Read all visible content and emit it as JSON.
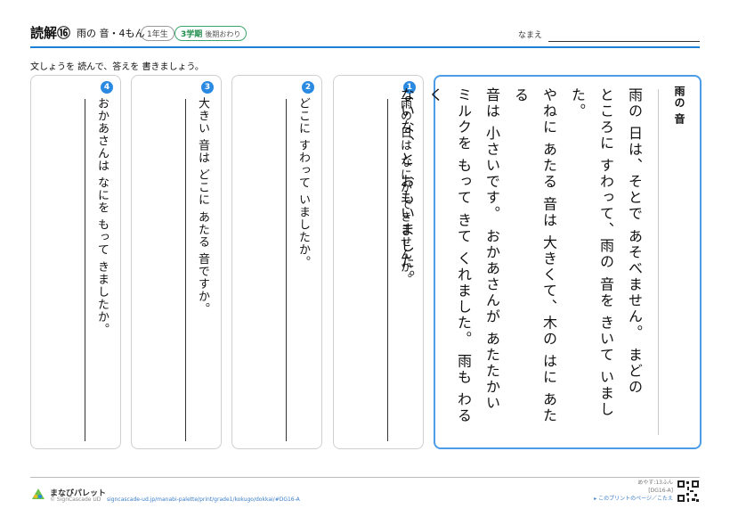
{
  "header": {
    "title": "読解⑯",
    "subtitle": "雨の 音・4もん",
    "grade_badge": "1年生",
    "term_badge": "3学期",
    "term_sub": "後期おわり",
    "name_label": "なまえ"
  },
  "instruction": "文しょうを 読んで、答えを 書きましょう。",
  "questions": [
    {
      "num": "1",
      "text": "雨の 日は なにが できませんか。"
    },
    {
      "num": "2",
      "text": "どこに すわって いましたか。"
    },
    {
      "num": "3",
      "text": "大きい 音は どこに あたる 音ですか。"
    },
    {
      "num": "4",
      "text": "おかあさんは なにを もって きましたか。"
    }
  ],
  "story": {
    "title": "雨の 音",
    "lines": [
      "雨の 日は、そとで あそべません。 まどの",
      "ところに すわって、雨の 音を きいて いました。",
      "やねに あたる 音は 大きくて、木の はに あたる",
      "音は 小さいです。 おかあさんが あたたかい",
      "ミルクを もって きて くれました。 雨も わるく",
      "ないな、と おもいました。"
    ]
  },
  "footer": {
    "brand": "まなびパレット",
    "copyright": "© SignCascade UD",
    "url": "signcascade-ud.jp/manabi-palette/print/grade1/kokugo/dokkai/#DG16-A",
    "time": "めやす:13ふん",
    "code": "[DG16-A]",
    "link": "▸ このプリントのページ／こたえ"
  },
  "colors": {
    "accent": "#1c7fd8",
    "story_border": "#4d9ce8",
    "term_badge": "#1f8c4c"
  }
}
